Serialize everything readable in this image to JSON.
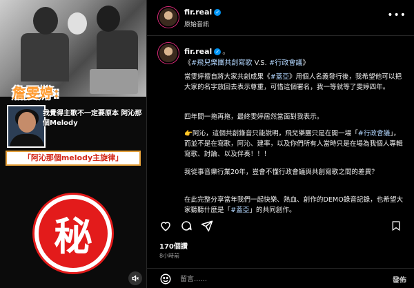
{
  "media": {
    "quote_title": "詹雯婷:",
    "quote_text": "我覺得主歌不一定要原本 阿沁那個Melody",
    "banner": "「阿沁那個melody主旋律」",
    "secret_char": "秘"
  },
  "header": {
    "username": "fir.real",
    "audio": "原始音訊"
  },
  "caption": {
    "username": "fir.real",
    "dot": "。",
    "subtitle_pre": "《",
    "subtitle_tag1": "#飛兒樂團共創寫歌",
    "subtitle_mid": " V.S. ",
    "subtitle_tag2": "#行政會議",
    "subtitle_post": "》",
    "p1_pre": "當雯婷擅自將大家共創成果《",
    "p1_tag": "#蓋亞",
    "p1_post": "》用個人名義發行後，我希望他可以把大家的名字放回去表示尊重，可惜這個署名，我一等就等了雯婷四年。",
    "p2": "四年間一拖再拖，最終雯婷居然當面對我表示。",
    "p3_pre": "👉阿沁，這個共創錄音只能說明，飛兒樂團只是在開一場「",
    "p3_tag": "#行政會議",
    "p3_post": "」，而並不是在寫歌，阿沁、建率，以及你們所有人當時只是在場為我個人專輯寫歌、討論、以及伴奏！！！",
    "p4": "我從事音樂行業20年，豈會不懂行政會議與共創寫歌之間的差異？",
    "p5_pre": "在此完整分享當年我們一起快樂、熱血、創作的DEMO錄音記錄，也希望大家聽聽什麼是「",
    "p5_tag": "#蓋亞",
    "p5_post": "」的共同創作。"
  },
  "stats": {
    "likes": "170個讚",
    "time": "8小時前"
  },
  "comment": {
    "placeholder": "留言......",
    "post_label": "發佈"
  }
}
